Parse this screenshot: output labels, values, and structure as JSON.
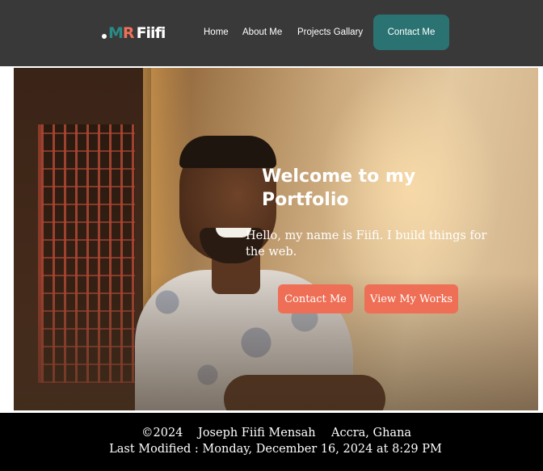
{
  "header": {
    "logo": {
      "prefix": "M",
      "r": "R",
      "name": "Fiifi"
    },
    "nav": {
      "home": "Home",
      "about": "About Me",
      "projects": "Projects Gallary",
      "contact": "Contact Me"
    }
  },
  "hero": {
    "title": "Welcome to my Portfolio",
    "subtitle": "Hello, my name is Fiifi. I build things for the web.",
    "buttons": {
      "contact": "Contact Me",
      "works": "View My Works"
    }
  },
  "footer": {
    "copyright": "©2024",
    "name": "Joseph Fiifi Mensah",
    "location": "Accra, Ghana",
    "last_modified": "Last Modified : Monday, December 16, 2024 at 8:29 PM"
  },
  "colors": {
    "header_bg": "#393939",
    "accent_teal": "#2b7373",
    "accent_coral": "#ee6f55",
    "footer_bg": "#000000"
  }
}
